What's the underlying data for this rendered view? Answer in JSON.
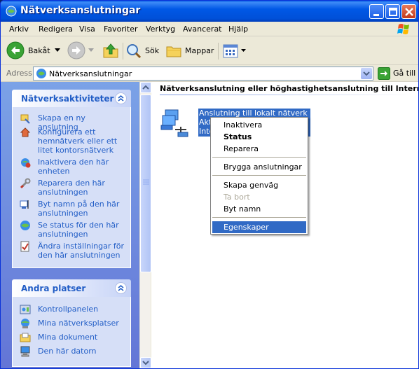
{
  "window": {
    "title": "Nätverksanslutningar"
  },
  "menubar": {
    "items": [
      "Arkiv",
      "Redigera",
      "Visa",
      "Favoriter",
      "Verktyg",
      "Avancerat",
      "Hjälp"
    ]
  },
  "toolbar": {
    "back_label": "Bakåt",
    "search_label": "Sök",
    "folders_label": "Mappar"
  },
  "address": {
    "label": "Adress",
    "value": "Nätverksanslutningar",
    "go_label": "Gå till"
  },
  "tasks_panel": {
    "title": "Nätverksaktiviteter",
    "items": [
      {
        "label": "Skapa en ny anslutning",
        "icon": "new-connection-icon"
      },
      {
        "label": "Konfigurera ett hemnätverk eller ett litet kontorsnätverk",
        "icon": "home-network-icon"
      },
      {
        "label": "Inaktivera den här enheten",
        "icon": "disable-device-icon"
      },
      {
        "label": "Reparera den här anslutningen",
        "icon": "repair-icon"
      },
      {
        "label": "Byt namn på den här anslutningen",
        "icon": "rename-icon"
      },
      {
        "label": "Se status för den här anslutningen",
        "icon": "status-icon"
      },
      {
        "label": "Ändra inställningar för den här anslutningen",
        "icon": "settings-icon"
      }
    ]
  },
  "places_panel": {
    "title": "Andra platser",
    "items": [
      {
        "label": "Kontrollpanelen",
        "icon": "control-panel-icon"
      },
      {
        "label": "Mina nätverksplatser",
        "icon": "network-places-icon"
      },
      {
        "label": "Mina dokument",
        "icon": "my-documents-icon"
      },
      {
        "label": "Den här datorn",
        "icon": "my-computer-icon"
      }
    ]
  },
  "content": {
    "group_title": "Nätverksanslutning eller höghastighetsanslutning till Internet",
    "connection_lines": [
      "Anslutning till lokalt nätverk",
      "Akt",
      "Inte"
    ]
  },
  "context_menu": {
    "items": [
      {
        "label": "Inaktivera",
        "style": "normal"
      },
      {
        "label": "Status",
        "style": "bold"
      },
      {
        "label": "Reparera",
        "style": "normal"
      },
      {
        "label": "Brygga anslutningar",
        "style": "normal"
      },
      {
        "label": "Skapa genväg",
        "style": "normal"
      },
      {
        "label": "Ta bort",
        "style": "disabled"
      },
      {
        "label": "Byt namn",
        "style": "normal"
      },
      {
        "label": "Egenskaper",
        "style": "selected"
      }
    ]
  },
  "colors": {
    "title_bar": "#0058e6",
    "selection": "#316ac5",
    "link": "#215dc6",
    "task_pane": "#7ba2e7"
  }
}
